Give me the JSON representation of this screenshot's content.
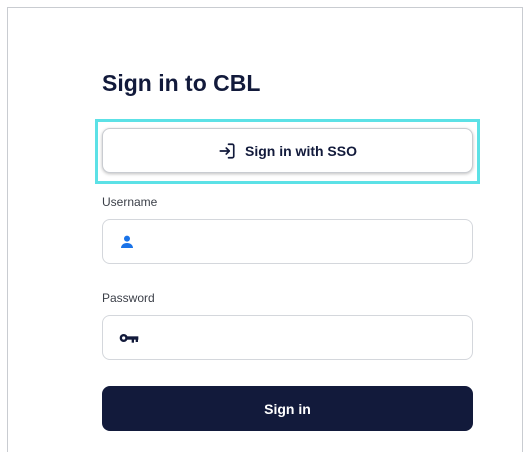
{
  "page": {
    "title": "Sign in to CBL"
  },
  "sso": {
    "label": "Sign in with SSO",
    "icon": "login-icon",
    "highlight_color": "#5ce1e6"
  },
  "username": {
    "label": "Username",
    "value": "",
    "icon": "person-icon",
    "icon_color": "#1a73e8"
  },
  "password": {
    "label": "Password",
    "value": "",
    "icon": "key-icon"
  },
  "submit": {
    "label": "Sign in",
    "color": "#121a3b"
  }
}
